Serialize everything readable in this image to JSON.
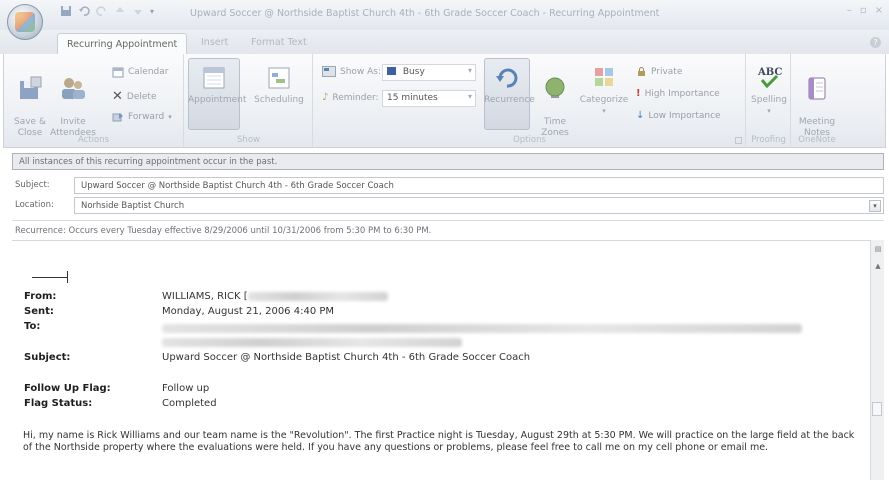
{
  "window": {
    "title": "Upward Soccer @ Northside Baptist Church  4th - 6th Grade Soccer Coach - Recurring Appointment"
  },
  "tabs": [
    {
      "label": "Recurring Appointment",
      "active": true
    },
    {
      "label": "Insert",
      "active": false
    },
    {
      "label": "Format Text",
      "active": false
    }
  ],
  "ribbon": {
    "actions": {
      "save_close": "Save &\nClose",
      "invite": "Invite\nAttendees",
      "calendar": "Calendar",
      "delete": "Delete",
      "forward": "Forward",
      "group_label": "Actions"
    },
    "show": {
      "appointment": "Appointment",
      "scheduling": "Scheduling",
      "group_label": "Show"
    },
    "options": {
      "show_as_label": "Show As:",
      "show_as_value": "Busy",
      "reminder_label": "Reminder:",
      "reminder_value": "15 minutes",
      "recurrence": "Recurrence",
      "time_zones": "Time\nZones",
      "categorize": "Categorize",
      "private": "Private",
      "high_importance": "High Importance",
      "low_importance": "Low Importance",
      "group_label": "Options"
    },
    "proofing": {
      "spelling": "Spelling",
      "group_label": "Proofing"
    },
    "onenote": {
      "meeting_notes": "Meeting\nNotes",
      "group_label": "OneNote"
    }
  },
  "infobar": "All instances of this recurring appointment occur in the past.",
  "fields": {
    "subject_label": "Subject:",
    "subject_value": "Upward Soccer @ Northside Baptist Church  4th - 6th Grade Soccer Coach",
    "location_label": "Location:",
    "location_value": "Norhside Baptist Church"
  },
  "recurrence": "Recurrence:  Occurs every Tuesday effective 8/29/2006 until 10/31/2006 from 5:30 PM to 6:30 PM.",
  "email": {
    "from_label": "From:",
    "from_value": "WILLIAMS, RICK [",
    "sent_label": "Sent:",
    "sent_value": "Monday, August 21, 2006 4:40 PM",
    "to_label": "To:",
    "subject_label": "Subject:",
    "subject_value": "Upward Soccer @ Northside Baptist Church  4th - 6th Grade Soccer Coach",
    "flag_label": "Follow Up Flag:",
    "flag_value": "Follow up",
    "status_label": "Flag Status:",
    "status_value": "Completed",
    "body": "Hi, my name is Rick Williams and our team name is the \"Revolution\".  The first Practice night is Tuesday, August 29th at 5:30 PM.  We will practice on the large field at the back of the Northside property where the evaluations were held.  If you have any questions or problems, please feel free to call me on my cell phone or email me."
  },
  "colors": {
    "accent_orange": "#e38b2c",
    "accent_blue": "#4a7fc0",
    "ribbon_text": "#a0a6ae"
  }
}
